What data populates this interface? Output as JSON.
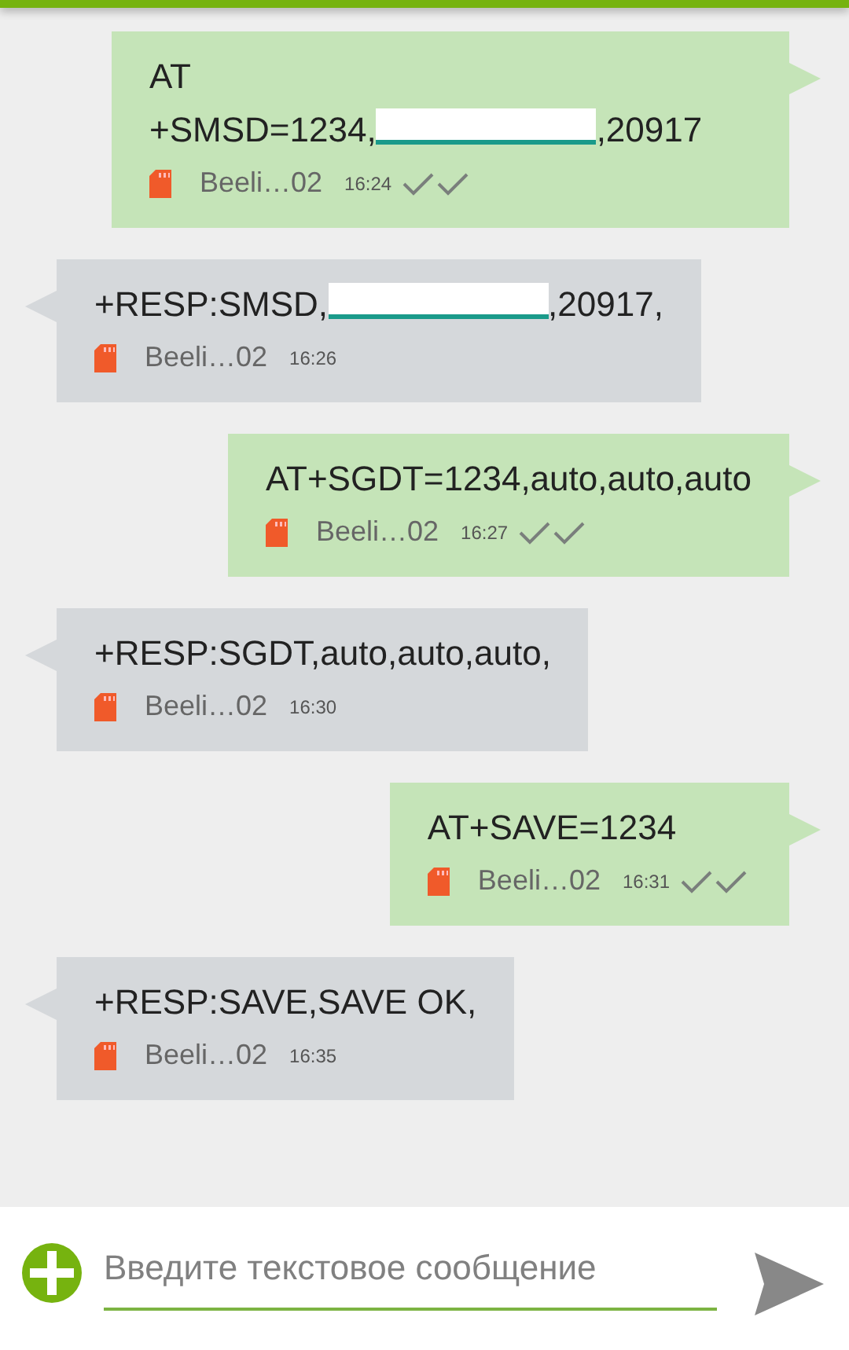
{
  "messages": [
    {
      "kind": "outgoing",
      "text": "AT +SMSD=1234,",
      "redacted": true,
      "text_after": ",20917",
      "sender": "Beeli…02",
      "time": "16:24",
      "delivered": true
    },
    {
      "kind": "incoming",
      "text": "+RESP:SMSD,",
      "redacted": true,
      "text_after": ",20917,",
      "sender": "Beeli…02",
      "time": "16:26",
      "delivered": false
    },
    {
      "kind": "outgoing",
      "text": "AT+SGDT=1234,auto,auto,auto",
      "redacted": false,
      "sender": "Beeli…02",
      "time": "16:27",
      "delivered": true
    },
    {
      "kind": "incoming",
      "text": "+RESP:SGDT,auto,auto,auto,",
      "redacted": false,
      "sender": "Beeli…02",
      "time": "16:30",
      "delivered": false
    },
    {
      "kind": "outgoing",
      "text": "AT+SAVE=1234",
      "redacted": false,
      "sender": "Beeli…02",
      "time": "16:31",
      "delivered": true
    },
    {
      "kind": "incoming",
      "text": "+RESP:SAVE,SAVE OK,",
      "redacted": false,
      "sender": "Beeli…02",
      "time": "16:35",
      "delivered": false
    }
  ],
  "composer": {
    "placeholder": "Введите текстовое сообщение"
  }
}
